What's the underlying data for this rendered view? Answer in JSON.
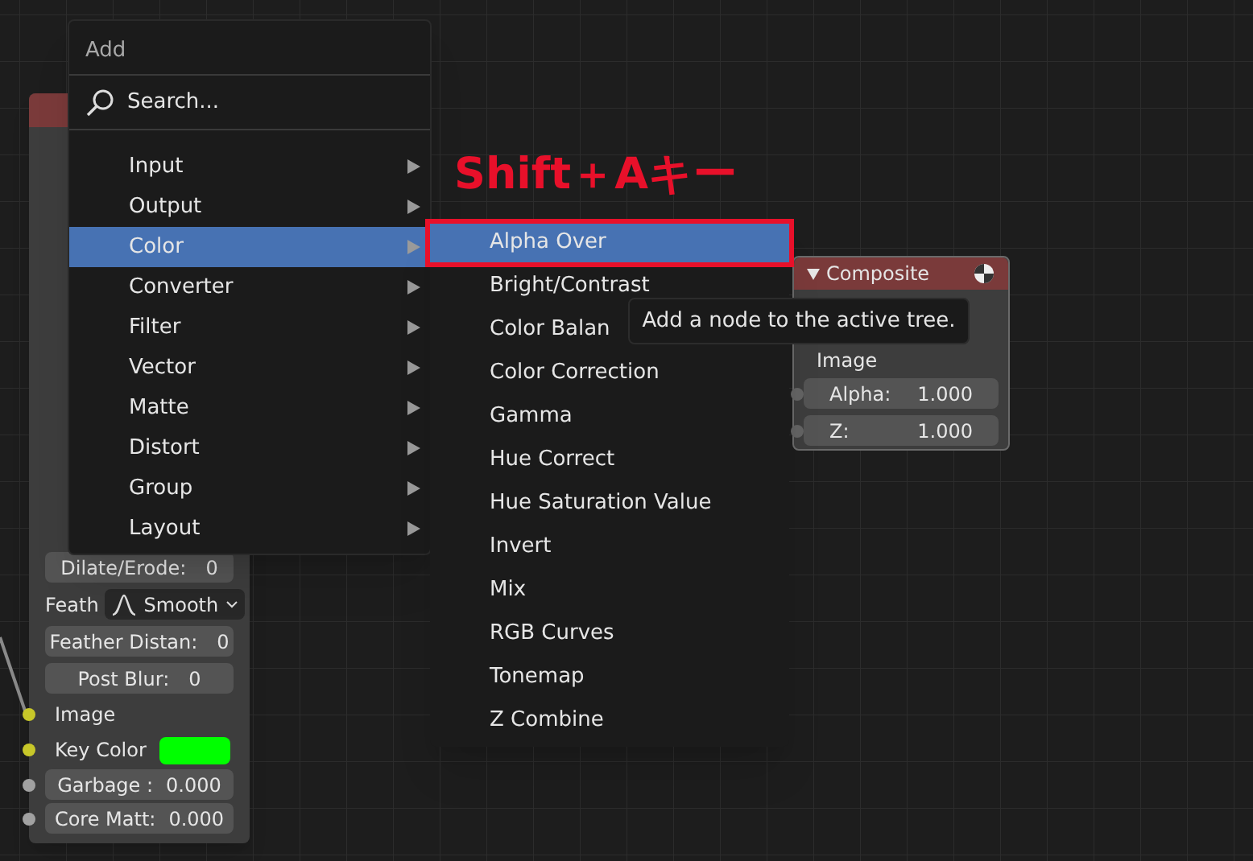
{
  "annotation": "Shift＋Aキー",
  "keying_node": {
    "rows": [
      {
        "kind": "field",
        "label": "Dilate/Erode:",
        "value": "0"
      },
      {
        "kind": "dropdown",
        "label": "Feath",
        "value": "Smooth"
      },
      {
        "kind": "field",
        "label": "Feather Distan:",
        "value": "0"
      },
      {
        "kind": "field",
        "label": "Post Blur:",
        "value": "0"
      },
      {
        "kind": "socket",
        "label": "Image",
        "socket": {
          "color": "#c7c729"
        }
      },
      {
        "kind": "swatch",
        "label": "Key Color",
        "color": "#00ff00",
        "socket": {
          "color": "#c7c729"
        }
      },
      {
        "kind": "socket_field",
        "label": "Garbage :",
        "value": "0.000",
        "socket": {
          "color": "#a1a1a1"
        }
      },
      {
        "kind": "socket_field",
        "label": "Core Matt:",
        "value": "0.000",
        "socket": {
          "color": "#a1a1a1"
        }
      }
    ]
  },
  "composite_node": {
    "title": "Composite",
    "socket_label": "Image",
    "fields": [
      {
        "label": "Alpha:",
        "value": "1.000"
      },
      {
        "label": "Z:",
        "value": "1.000"
      }
    ]
  },
  "add_menu": {
    "title": "Add",
    "search": "Search...",
    "items": [
      {
        "label": "Input",
        "selected": false
      },
      {
        "label": "Output",
        "selected": false
      },
      {
        "label": "Color",
        "selected": true
      },
      {
        "label": "Converter",
        "selected": false
      },
      {
        "label": "Filter",
        "selected": false
      },
      {
        "label": "Vector",
        "selected": false
      },
      {
        "label": "Matte",
        "selected": false
      },
      {
        "label": "Distort",
        "selected": false
      },
      {
        "label": "Group",
        "selected": false
      },
      {
        "label": "Layout",
        "selected": false
      }
    ]
  },
  "color_submenu": {
    "items": [
      {
        "label": "Alpha Over",
        "selected": true
      },
      {
        "label": "Bright/Contrast",
        "selected": false
      },
      {
        "label": "Color Balan",
        "selected": false
      },
      {
        "label": "Color Correction",
        "selected": false
      },
      {
        "label": "Gamma",
        "selected": false
      },
      {
        "label": "Hue Correct",
        "selected": false
      },
      {
        "label": "Hue Saturation Value",
        "selected": false
      },
      {
        "label": "Invert",
        "selected": false
      },
      {
        "label": "Mix",
        "selected": false
      },
      {
        "label": "RGB Curves",
        "selected": false
      },
      {
        "label": "Tonemap",
        "selected": false
      },
      {
        "label": "Z Combine",
        "selected": false
      }
    ]
  },
  "tooltip": "Add a node to the active tree."
}
